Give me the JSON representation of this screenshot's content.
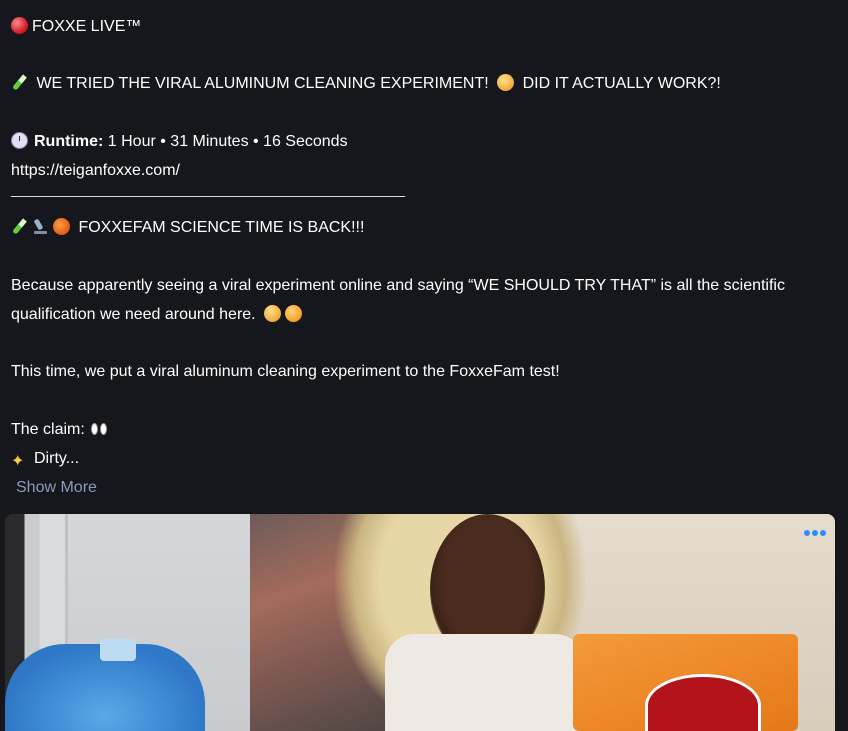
{
  "post": {
    "channel": "FOXXE LIVE™",
    "title": "WE TRIED THE VIRAL ALUMINUM CLEANING EXPERIMENT! 😳 DID IT ACTUALLY WORK?!",
    "title_part1": "WE TRIED THE VIRAL ALUMINUM CLEANING EXPERIMENT!",
    "title_part2": "DID IT ACTUALLY WORK?!",
    "runtime_label": "Runtime:",
    "runtime_value": "1 Hour • 31 Minutes • 16 Seconds",
    "url": "https://teiganfoxxe.com/",
    "section_heading": "FOXXEFAM SCIENCE TIME IS BACK!!!",
    "paragraph1_line1": "Because apparently seeing a viral experiment online and saying “WE SHOULD TRY THAT” is all the scientific",
    "paragraph1_line2": "qualification we need around here.",
    "paragraph2": "This time, we put a viral aluminum cleaning experiment to the FoxxeFam test!",
    "claim_label": "The claim:",
    "dirty_text": "Dirty...",
    "show_more": "Show More"
  },
  "media": {
    "menu_icon": "more-dots-icon",
    "accent": "#2f8cff"
  }
}
